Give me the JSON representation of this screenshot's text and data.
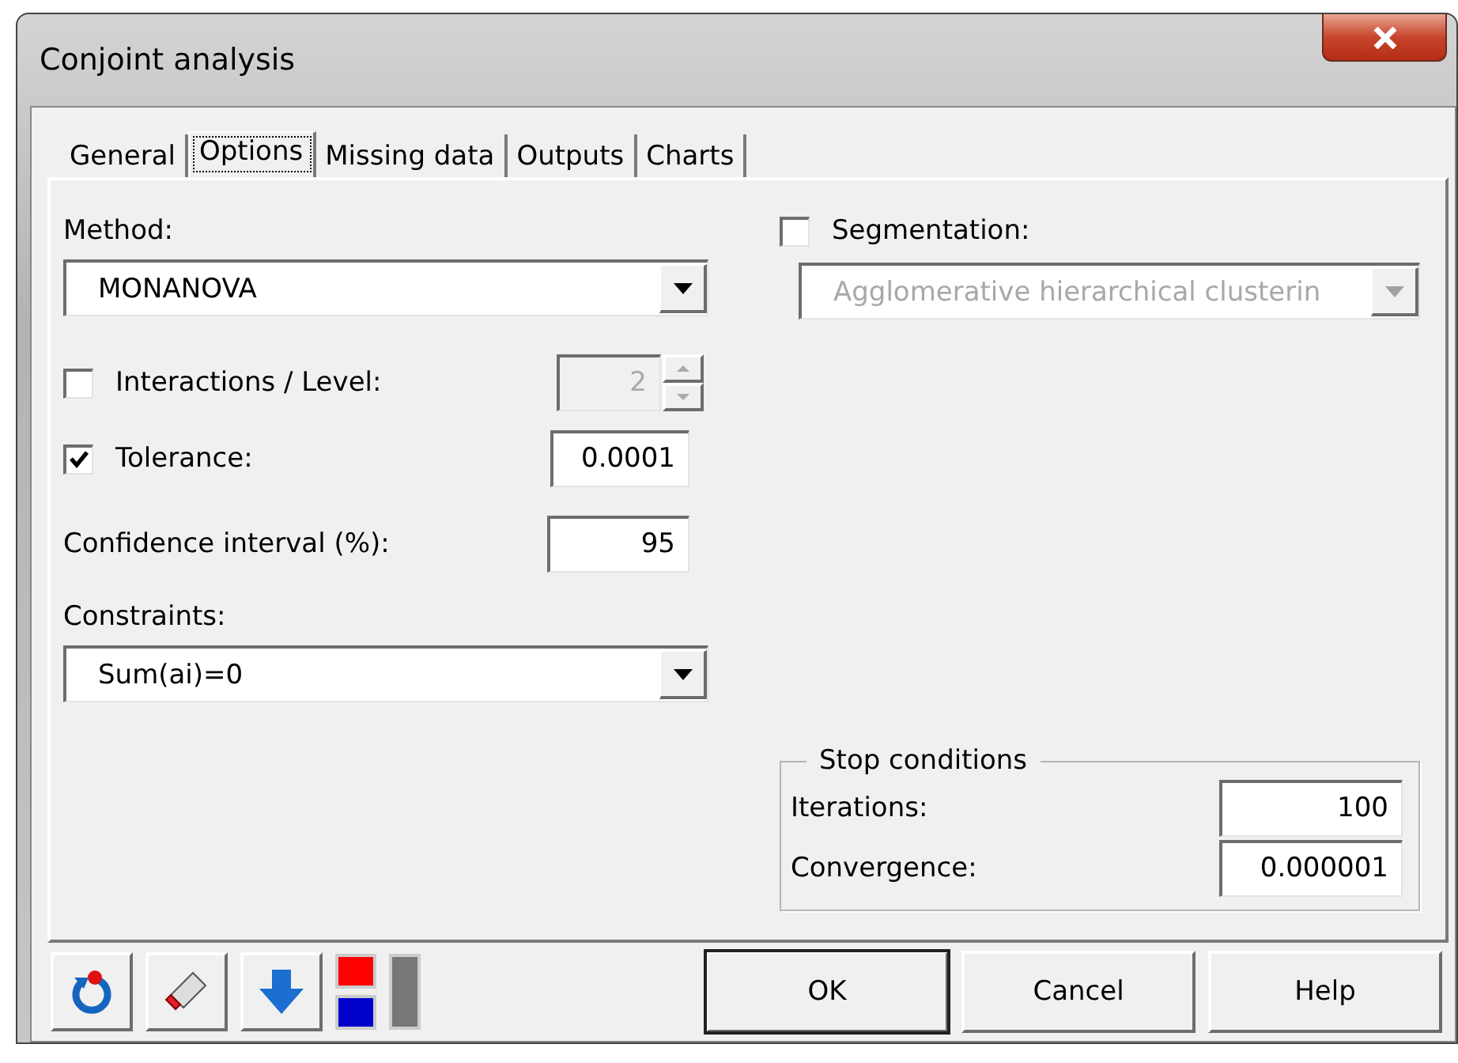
{
  "window": {
    "title": "Conjoint analysis"
  },
  "tabs": [
    {
      "label": "General",
      "selected": false
    },
    {
      "label": "Options",
      "selected": true
    },
    {
      "label": "Missing data",
      "selected": false
    },
    {
      "label": "Outputs",
      "selected": false
    },
    {
      "label": "Charts",
      "selected": false
    }
  ],
  "method": {
    "label": "Method:",
    "value": "MONANOVA"
  },
  "interactions": {
    "label": "Interactions / Level:",
    "checked": false,
    "value": "2"
  },
  "tolerance": {
    "label": "Tolerance:",
    "checked": true,
    "value": "0.0001"
  },
  "confidence": {
    "label": "Confidence interval (%):",
    "value": "95"
  },
  "constraints": {
    "label": "Constraints:",
    "value": "Sum(ai)=0"
  },
  "segmentation": {
    "label": "Segmentation:",
    "checked": false,
    "value": "Agglomerative hierarchical clusterin"
  },
  "stop_conditions": {
    "title": "Stop conditions",
    "fields": [
      {
        "label": "Iterations:",
        "value": "100"
      },
      {
        "label": "Convergence:",
        "value": "0.000001"
      }
    ]
  },
  "buttons": [
    {
      "label": "OK",
      "default": true
    },
    {
      "label": "Cancel",
      "default": false
    },
    {
      "label": "Help",
      "default": false
    }
  ]
}
